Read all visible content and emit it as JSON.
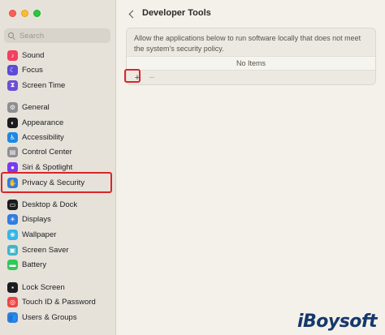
{
  "sidebar": {
    "search_placeholder": "Search",
    "items": [
      {
        "label": "Sound",
        "icon": "speaker-icon",
        "color": "#f43f5e",
        "glyph": "♪"
      },
      {
        "label": "Focus",
        "icon": "moon-icon",
        "color": "#5b4bd6",
        "glyph": "☾"
      },
      {
        "label": "Screen Time",
        "icon": "hourglass-icon",
        "color": "#6d4fd6",
        "glyph": "⧗"
      },
      {
        "label": "General",
        "icon": "gear-icon",
        "color": "#8e8e93",
        "glyph": "⚙"
      },
      {
        "label": "Appearance",
        "icon": "appearance-icon",
        "color": "#1c1c1e",
        "glyph": "◐"
      },
      {
        "label": "Accessibility",
        "icon": "accessibility-icon",
        "color": "#1e88e5",
        "glyph": "♿"
      },
      {
        "label": "Control Center",
        "icon": "control-center-icon",
        "color": "#8e8e93",
        "glyph": "▤"
      },
      {
        "label": "Siri & Spotlight",
        "icon": "siri-icon",
        "color": "#7c3aed",
        "glyph": "●"
      },
      {
        "label": "Privacy & Security",
        "icon": "hand-icon",
        "color": "#2f7de1",
        "glyph": "✋"
      },
      {
        "label": "Desktop & Dock",
        "icon": "dock-icon",
        "color": "#1c1c1e",
        "glyph": "▭"
      },
      {
        "label": "Displays",
        "icon": "sun-icon",
        "color": "#2f7de1",
        "glyph": "☀"
      },
      {
        "label": "Wallpaper",
        "icon": "wallpaper-icon",
        "color": "#35b6e8",
        "glyph": "❀"
      },
      {
        "label": "Screen Saver",
        "icon": "screen-saver-icon",
        "color": "#3fb5c9",
        "glyph": "▣"
      },
      {
        "label": "Battery",
        "icon": "battery-icon",
        "color": "#34c759",
        "glyph": "▬"
      },
      {
        "label": "Lock Screen",
        "icon": "lock-icon",
        "color": "#1c1c1e",
        "glyph": "▪"
      },
      {
        "label": "Touch ID & Password",
        "icon": "fingerprint-icon",
        "color": "#ef4444",
        "glyph": "◎"
      },
      {
        "label": "Users & Groups",
        "icon": "users-icon",
        "color": "#2f7de1",
        "glyph": "👥"
      }
    ]
  },
  "main": {
    "title": "Developer Tools",
    "description": "Allow the applications below to run software locally that does not meet the system's security policy.",
    "empty_list": "No Items",
    "add_label": "+",
    "remove_label": "–"
  },
  "watermark": "iBoysoft"
}
